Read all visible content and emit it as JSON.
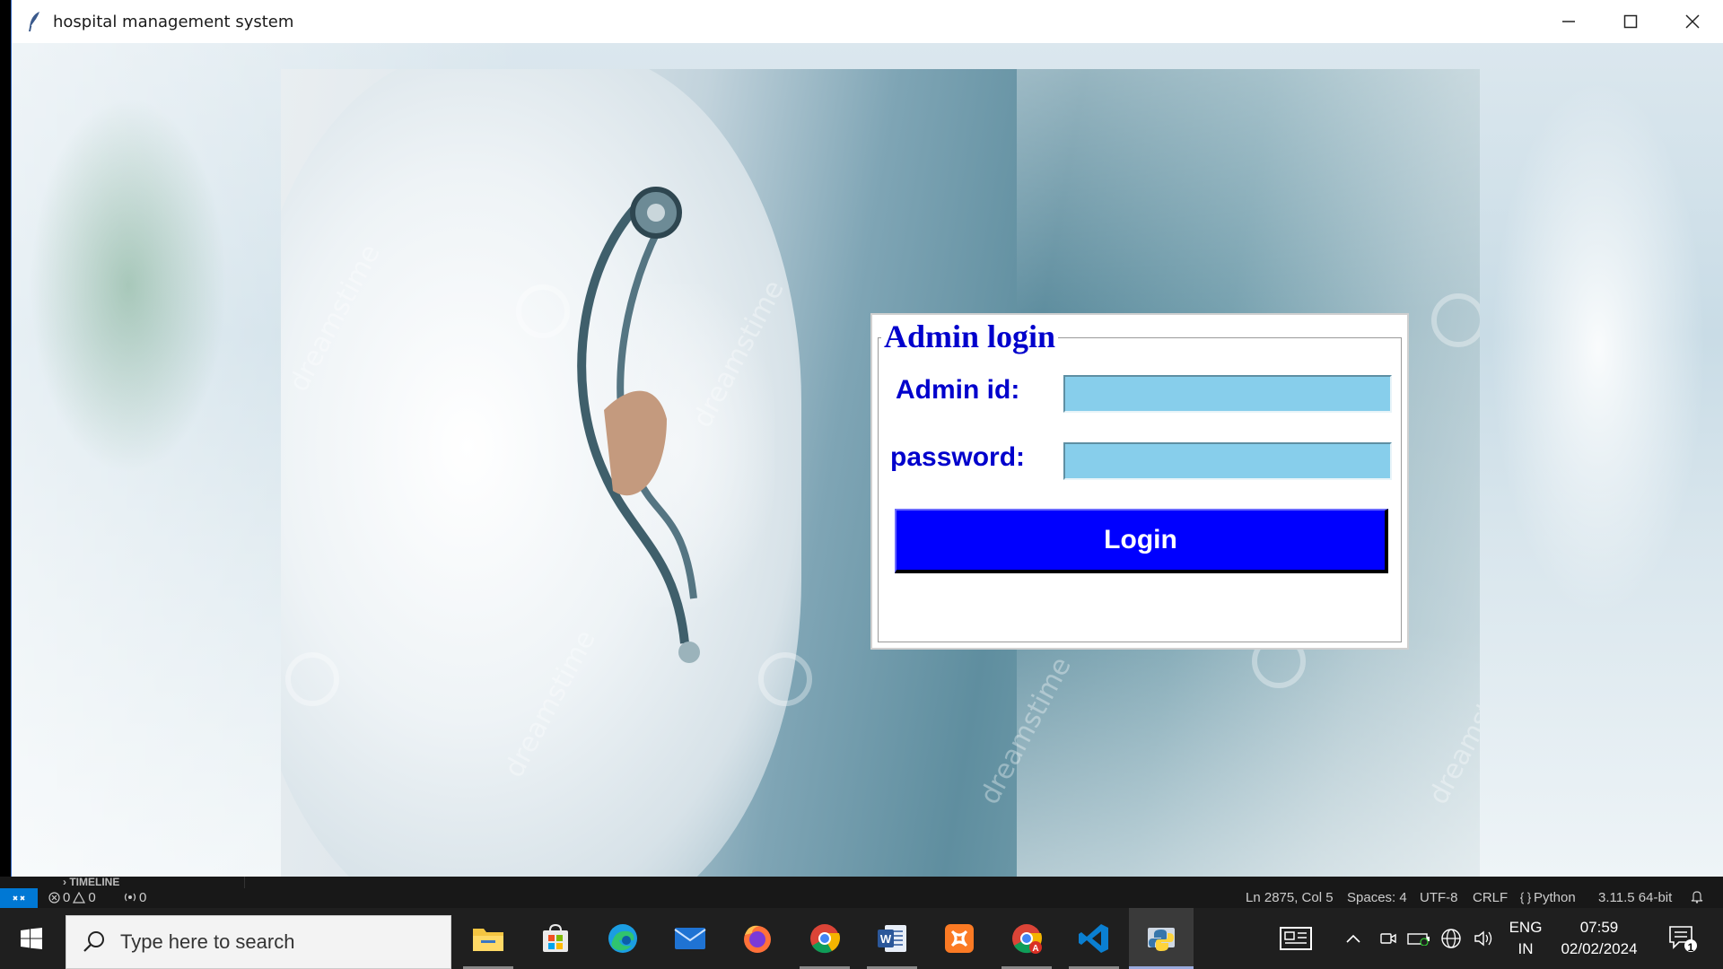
{
  "window": {
    "title": "hospital management system"
  },
  "login": {
    "title": "Admin login",
    "admin_id_label": "Admin id:",
    "admin_id_value": "",
    "password_label": "password:",
    "password_value": "",
    "login_button": "Login"
  },
  "photo": {
    "watermark": "dreamstime"
  },
  "vscode": {
    "timeline_label": "TIMELINE",
    "errors": "0",
    "warnings": "0",
    "ports": "0",
    "cursor_position": "Ln 2875, Col 5",
    "spaces": "Spaces: 4",
    "encoding": "UTF-8",
    "line_ending": "CRLF",
    "language": "Python",
    "interpreter": "3.11.5 64-bit"
  },
  "taskbar": {
    "search_placeholder": "Type here to search",
    "apps": [
      "file-explorer",
      "microsoft-store",
      "edge",
      "mail",
      "firefox",
      "chrome",
      "word",
      "xampp",
      "chrome-profile",
      "vscode",
      "python"
    ],
    "language_top": "ENG",
    "language_bottom": "IN",
    "time": "07:59",
    "date": "02/02/2024",
    "notification_count": "1"
  },
  "colors": {
    "accent_blue": "#0000ff",
    "label_blue": "#0000cc",
    "input_bg": "#87ceeb",
    "status_remote": "#0078d4"
  }
}
